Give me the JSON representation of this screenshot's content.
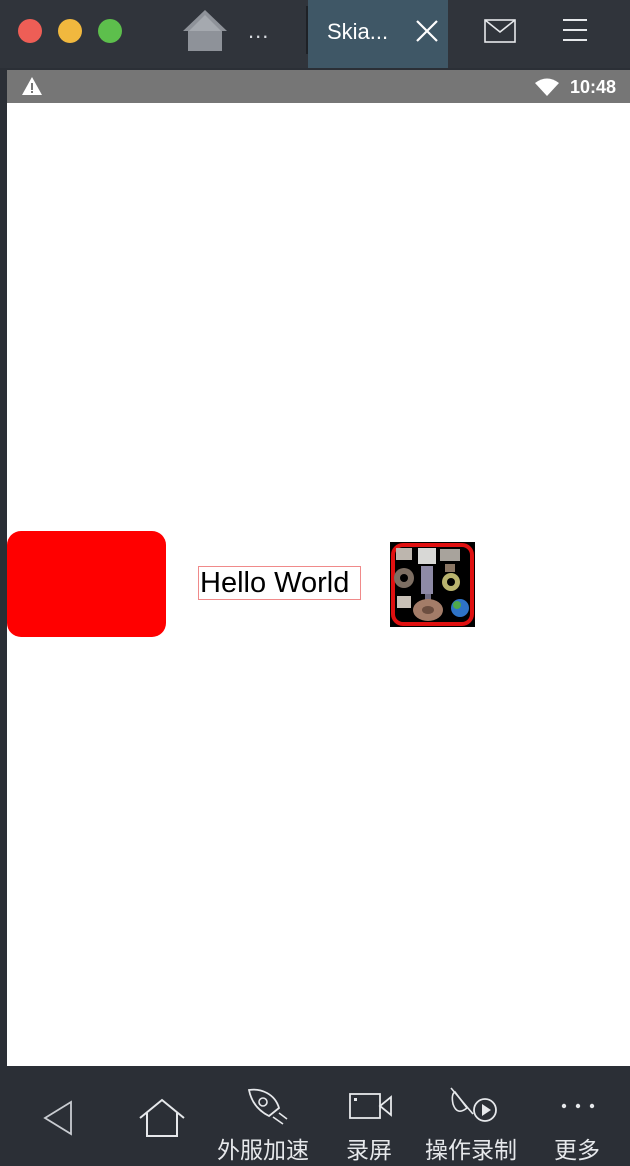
{
  "window": {
    "tab_title": "Skia...",
    "overflow_label": "..."
  },
  "status_bar": {
    "time": "10:48",
    "icons": [
      "warning-icon",
      "wifi-icon"
    ]
  },
  "content": {
    "text": "Hello World",
    "shape_color": "#ff0000",
    "image_border_color": "#e01010"
  },
  "nav": {
    "items": [
      {
        "icon": "back-icon",
        "label": ""
      },
      {
        "icon": "home-icon",
        "label": ""
      },
      {
        "icon": "rocket-icon",
        "label": "外服加速"
      },
      {
        "icon": "video-camera-icon",
        "label": "录屏"
      },
      {
        "icon": "macro-record-icon",
        "label": "操作录制"
      },
      {
        "icon": "more-icon",
        "label": "更多"
      }
    ]
  }
}
